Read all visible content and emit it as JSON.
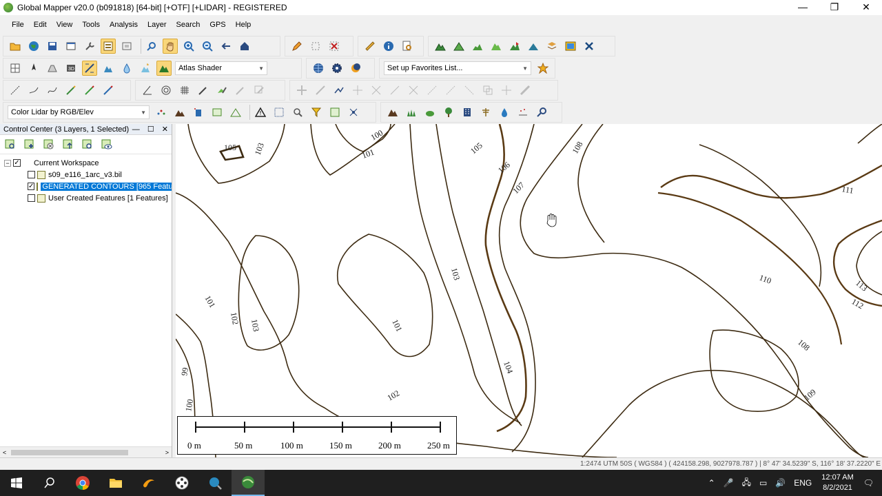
{
  "window": {
    "title": "Global Mapper v20.0 (b091818) [64-bit] [+OTF] [+LIDAR] - REGISTERED",
    "minimize_glyph": "—",
    "maximize_glyph": "❐",
    "close_glyph": "✕"
  },
  "menu": [
    "File",
    "Edit",
    "View",
    "Tools",
    "Analysis",
    "Layer",
    "Search",
    "GPS",
    "Help"
  ],
  "toolbars": {
    "shader_select": "Atlas Shader",
    "favorites_select": "Set up Favorites List...",
    "lidar_color_select": "Color Lidar by RGB/Elev"
  },
  "control_center": {
    "title": "Control Center (3 Layers, 1 Selected)",
    "pin_glyph": "—",
    "float_glyph": "☐",
    "close_glyph": "✕",
    "tree": [
      {
        "label": "Current Workspace",
        "checked": true,
        "selected": false
      },
      {
        "label": "s09_e116_1arc_v3.bil",
        "checked": false,
        "selected": false
      },
      {
        "label": "GENERATED CONTOURS [965 Features]",
        "checked": true,
        "selected": true
      },
      {
        "label": "User Created Features [1 Features]",
        "checked": false,
        "selected": false
      }
    ],
    "scroll_left": "<",
    "scroll_right": ">"
  },
  "map": {
    "contour_labels": [
      "105",
      "103",
      "100",
      "101",
      "105",
      "106",
      "107",
      "108",
      "111",
      "103",
      "101",
      "102",
      "103",
      "101",
      "104",
      "102",
      "110",
      "113",
      "112",
      "108",
      "109",
      "99",
      "100"
    ],
    "scale_bar": {
      "ticks": [
        "0 m",
        "50 m",
        "100 m",
        "150 m",
        "200 m",
        "250 m"
      ]
    }
  },
  "status": {
    "text": "1:2474  UTM 50S ( WGS84 ) ( 424158.298, 9027978.787 ) | 8° 47' 34.5239\" S, 116° 18' 37.2220\" E"
  },
  "taskbar": {
    "language": "ENG",
    "time": "12:07 AM",
    "date": "8/2/2021"
  },
  "colors": {
    "contour": "#3d2b12",
    "selection": "#0078d7",
    "taskbar": "#1f1f1f"
  }
}
